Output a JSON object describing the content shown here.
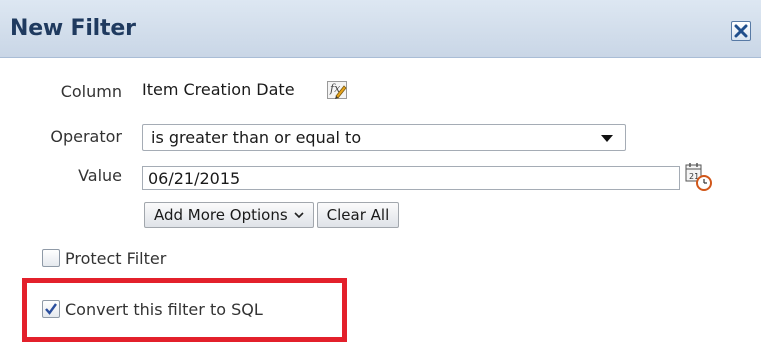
{
  "dialog": {
    "title": "New Filter",
    "close_icon": "close-icon"
  },
  "form": {
    "column_label": "Column",
    "column_value": "Item Creation Date",
    "column_edit_icon": "formula-edit-icon",
    "operator_label": "Operator",
    "operator_selected": "is greater than or equal to",
    "value_label": "Value",
    "value_text": "06/21/2015",
    "calendar_icon": "calendar-icon",
    "add_more_options_label": "Add More Options",
    "clear_all_label": "Clear All"
  },
  "options": {
    "protect_filter_label": "Protect Filter",
    "protect_filter_checked": false,
    "convert_sql_label": "Convert this filter to SQL",
    "convert_sql_checked": true
  },
  "colors": {
    "title_text": "#1f3a5f",
    "titlebar_bg": "#c9d6e6",
    "highlight": "#e3202b",
    "checkmark": "#2b4f9e"
  }
}
